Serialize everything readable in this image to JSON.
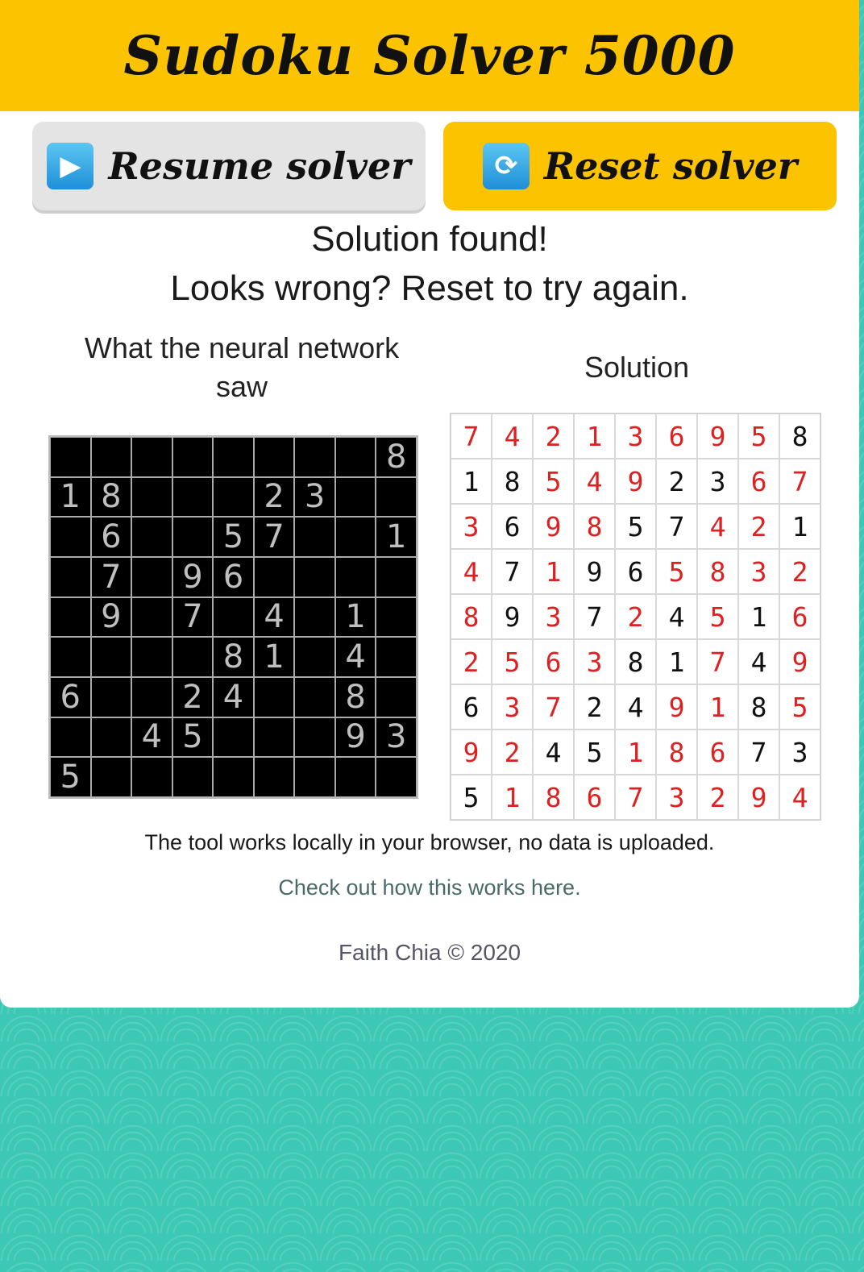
{
  "app": {
    "title": "Sudoku Solver 5000"
  },
  "buttons": {
    "resume": {
      "label": "Resume solver",
      "icon": "play-icon"
    },
    "reset": {
      "label": "Reset solver",
      "icon": "refresh-icon"
    }
  },
  "status": {
    "line1": "Solution found!",
    "line2": "Looks wrong? Reset to try again."
  },
  "labels": {
    "nn": "What the neural network saw",
    "solution": "Solution"
  },
  "nn_grid": [
    [
      "",
      "",
      "",
      "",
      "",
      "",
      "",
      "",
      "8"
    ],
    [
      "1",
      "8",
      "",
      "",
      "",
      "2",
      "3",
      "",
      ""
    ],
    [
      "",
      "6",
      "",
      "",
      "5",
      "7",
      "",
      "",
      "1"
    ],
    [
      "",
      "7",
      "",
      "9",
      "6",
      "",
      "",
      "",
      ""
    ],
    [
      "",
      "9",
      "",
      "7",
      "",
      "4",
      "",
      "1",
      ""
    ],
    [
      "",
      "",
      "",
      "",
      "8",
      "1",
      "",
      "4",
      ""
    ],
    [
      "6",
      "",
      "",
      "2",
      "4",
      "",
      "",
      "8",
      ""
    ],
    [
      "",
      "",
      "4",
      "5",
      "",
      "",
      "",
      "9",
      "3"
    ],
    [
      "5",
      "",
      "",
      "",
      "",
      "",
      "",
      "",
      ""
    ]
  ],
  "solution_grid": [
    [
      "7",
      "4",
      "2",
      "1",
      "3",
      "6",
      "9",
      "5",
      "8"
    ],
    [
      "1",
      "8",
      "5",
      "4",
      "9",
      "2",
      "3",
      "6",
      "7"
    ],
    [
      "3",
      "6",
      "9",
      "8",
      "5",
      "7",
      "4",
      "2",
      "1"
    ],
    [
      "4",
      "7",
      "1",
      "9",
      "6",
      "5",
      "8",
      "3",
      "2"
    ],
    [
      "8",
      "9",
      "3",
      "7",
      "2",
      "4",
      "5",
      "1",
      "6"
    ],
    [
      "2",
      "5",
      "6",
      "3",
      "8",
      "1",
      "7",
      "4",
      "9"
    ],
    [
      "6",
      "3",
      "7",
      "2",
      "4",
      "9",
      "1",
      "8",
      "5"
    ],
    [
      "9",
      "2",
      "4",
      "5",
      "1",
      "8",
      "6",
      "7",
      "3"
    ],
    [
      "5",
      "1",
      "8",
      "6",
      "7",
      "3",
      "2",
      "9",
      "4"
    ]
  ],
  "footer": {
    "note": "The tool works locally in your browser, no data is uploaded.",
    "link": "Check out how this works here.",
    "copyright": "Faith Chia © 2020"
  },
  "colors": {
    "accent": "#fbc300",
    "solved_digit": "#e02020",
    "background": "#3cc8b4"
  }
}
